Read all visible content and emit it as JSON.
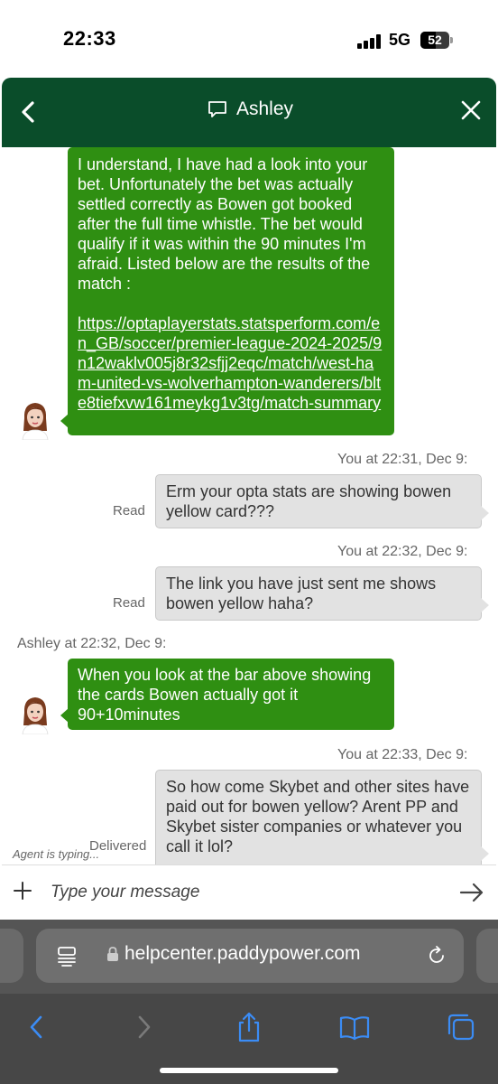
{
  "status_bar": {
    "time": "22:33",
    "network": "5G",
    "battery": "52"
  },
  "header": {
    "agent_name": "Ashley",
    "back_icon": "chevron-left-icon",
    "chat_icon": "chat-bubble-icon",
    "close_icon": "close-icon"
  },
  "messages": [
    {
      "type": "agent",
      "text": "I understand, I have had a look into your bet. Unfortunately the bet was actually settled correctly as Bowen got booked after the full time whistle. The bet would qualify if it was within the 90 minutes I'm afraid. Listed below are the results of the match :",
      "link": "https://optaplayerstats.statsperform.com/en_GB/soccer/premier-league-2024-2025/9n12waklv005j8r32sfjj2eqc/match/west-ham-united-vs-wolverhampton-wanderers/blte8tiefxvw161meykg1v3tg/match-summary"
    },
    {
      "type": "user",
      "meta": "You at 22:31, Dec 9:",
      "text": "Erm your opta stats are showing bowen yellow card???",
      "receipt": "Read"
    },
    {
      "type": "user",
      "meta": "You at 22:32, Dec 9:",
      "text": "The link you have just sent me shows bowen yellow haha?",
      "receipt": "Read"
    },
    {
      "type": "agent",
      "meta": "Ashley at 22:32, Dec 9:",
      "text": "When you look at the bar above showing the cards Bowen actually got it 90+10minutes"
    },
    {
      "type": "user",
      "meta": "You at 22:33, Dec 9:",
      "text": "So how come Skybet and other sites have paid out for bowen yellow? Arent PP and Skybet sister companies or whatever you call it lol?",
      "receipt": "Delivered"
    }
  ],
  "typing_indicator": "Agent is typing...",
  "composer": {
    "placeholder": "Type your message",
    "add_icon": "plus-icon",
    "send_icon": "send-arrow-icon"
  },
  "browser": {
    "url": "helpcenter.paddypower.com"
  },
  "colors": {
    "header_bg": "#0a4d2a",
    "agent_bubble": "#2f8f12",
    "user_bubble": "#e2e2e2"
  }
}
